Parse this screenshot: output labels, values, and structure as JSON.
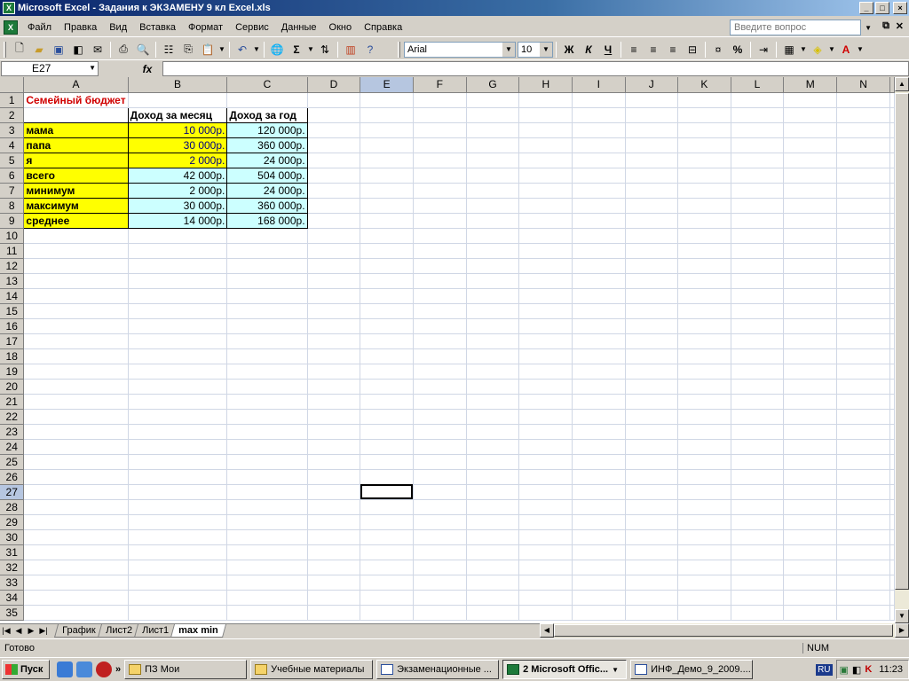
{
  "window": {
    "title": "Microsoft Excel - Задания к ЭКЗАМЕНУ 9 кл Excel.xls",
    "min": "_",
    "max": "□",
    "close": "×"
  },
  "menu": {
    "items": [
      "Файл",
      "Правка",
      "Вид",
      "Вставка",
      "Формат",
      "Сервис",
      "Данные",
      "Окно",
      "Справка"
    ],
    "ask_placeholder": "Введите вопрос"
  },
  "toolbar": {
    "font": "Arial",
    "size": "10",
    "bold": "Ж",
    "italic": "К",
    "underline": "Ч",
    "percent": "%",
    "sigma": "Σ"
  },
  "formula_bar": {
    "cell_ref": "E27",
    "fx": "fx",
    "content": ""
  },
  "columns": [
    "A",
    "B",
    "C",
    "D",
    "E",
    "F",
    "G",
    "H",
    "I",
    "J",
    "K",
    "L",
    "M",
    "N"
  ],
  "sheet": {
    "title": "Семейный бюджет",
    "header_b": "Доход за месяц",
    "header_c": "Доход за год",
    "rows": [
      {
        "label": "мама",
        "month": "10 000р.",
        "year": "120 000р."
      },
      {
        "label": "папа",
        "month": "30 000р.",
        "year": "360 000р."
      },
      {
        "label": "я",
        "month": "2 000р.",
        "year": "24 000р."
      },
      {
        "label": "всего",
        "month": "42 000р.",
        "year": "504 000р."
      },
      {
        "label": "минимум",
        "month": "2 000р.",
        "year": "24 000р."
      },
      {
        "label": "максимум",
        "month": "30 000р.",
        "year": "360 000р."
      },
      {
        "label": "среднее",
        "month": "14 000р.",
        "year": "168 000р."
      }
    ]
  },
  "tabs": [
    "График",
    "Лист2",
    "Лист1",
    "max min"
  ],
  "active_tab": "max min",
  "status": {
    "text": "Готово",
    "num": "NUM"
  },
  "taskbar": {
    "start": "Пуск",
    "tasks": [
      "ПЗ Мои",
      "Учебные материалы",
      "Экзаменационные ...",
      "2 Microsoft Offic...",
      "ИНФ_Демо_9_2009...."
    ],
    "lang": "RU",
    "clock": "11:23"
  }
}
